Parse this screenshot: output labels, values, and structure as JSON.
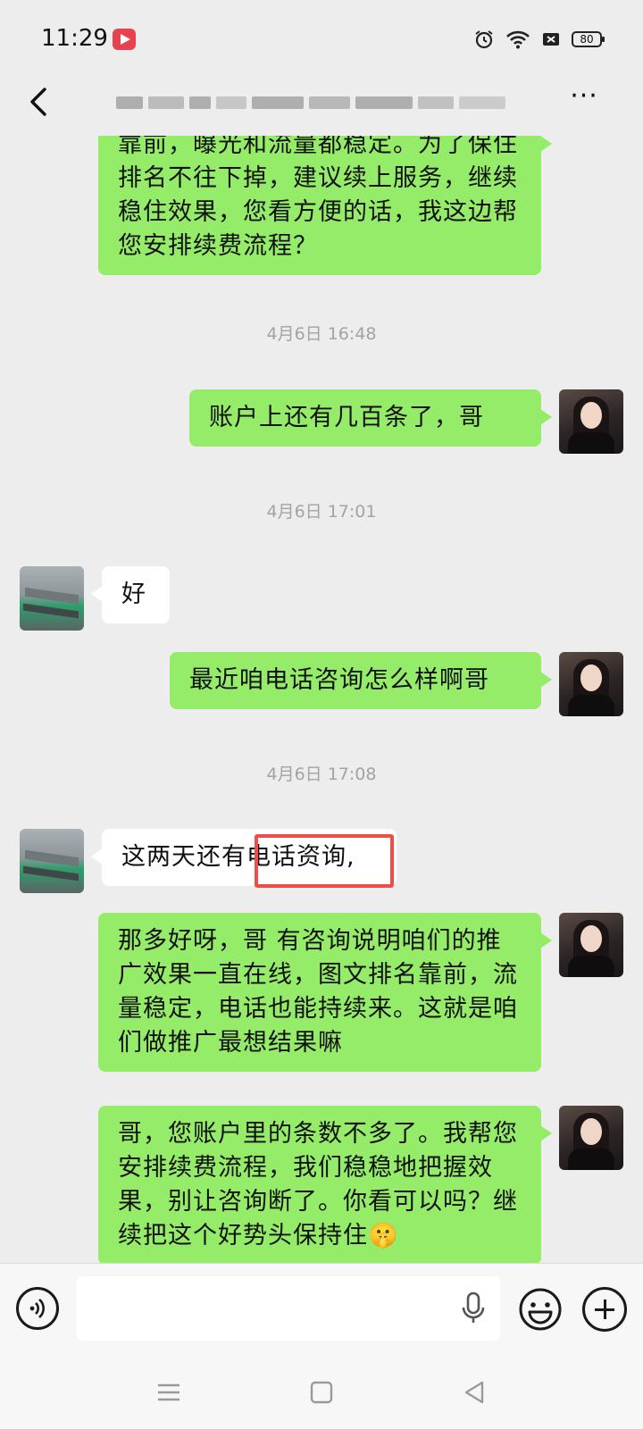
{
  "status_bar": {
    "time": "11:29",
    "app_badge_icon": "video-app-icon",
    "battery": "80",
    "icons": [
      "alarm-icon",
      "wifi-icon",
      "sim-off-icon",
      "battery-icon"
    ]
  },
  "header": {
    "back_icon": "chevron-left-icon",
    "title_redacted": true,
    "more_label": "···"
  },
  "messages": [
    {
      "type": "me",
      "text": "靠前，曝光和流量都稳定。为了保住排名不往下掉，建议续上服务，继续稳住效果，您看方便的话，我这边帮您安排续费流程？"
    },
    {
      "type": "time",
      "text": "4月6日 16:48"
    },
    {
      "type": "me",
      "text": "账户上还有几百条了，哥"
    },
    {
      "type": "time",
      "text": "4月6日 17:01"
    },
    {
      "type": "them",
      "text": "好"
    },
    {
      "type": "me",
      "text": "最近咱电话咨询怎么样啊哥"
    },
    {
      "type": "time",
      "text": "4月6日 17:08"
    },
    {
      "type": "them",
      "text_before": "这两天还有",
      "text_highlight": "电话资询,"
    },
    {
      "type": "me",
      "text": "那多好呀，哥 有咨询说明咱们的推广效果一直在线，图文排名靠前，流量稳定，电话也能持续来。这就是咱们做推广最想结果嘛"
    },
    {
      "type": "me",
      "text": "哥，您账户里的条数不多了。我帮您安排续费流程，我们稳稳地把握效果，别让咨询断了。你看可以吗？继续把这个好势头保持住🤫"
    }
  ],
  "input_bar": {
    "placeholder": "",
    "voice_icon": "voice-icon",
    "mic_icon": "mic-icon",
    "emoji_icon": "emoji-icon",
    "plus_icon": "plus-icon"
  },
  "nav_bar": {
    "icons": [
      "menu-icon",
      "home-icon",
      "back-triangle-icon"
    ]
  },
  "colors": {
    "background": "#ededed",
    "my_bubble": "#95ec69",
    "their_bubble": "#ffffff",
    "timestamp": "#a3a3a3",
    "highlight": "#f24b48"
  }
}
